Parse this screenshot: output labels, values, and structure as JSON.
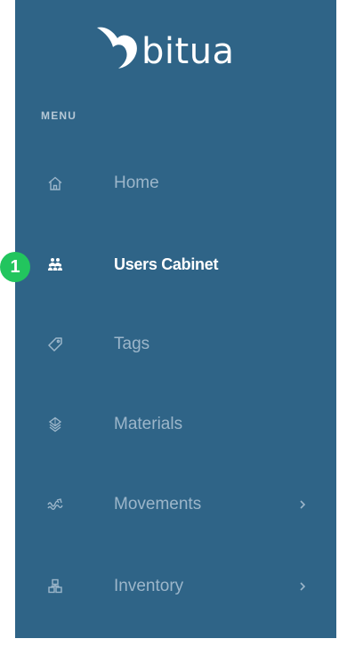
{
  "brand": {
    "name": "bitua",
    "logo_icon": "bitua-swoosh-logo",
    "color": "#ffffff"
  },
  "sidebar": {
    "background": "#2f6487",
    "menu_heading": "MENU",
    "items": [
      {
        "label": "Home",
        "icon": "home-icon",
        "active": false,
        "has_submenu": false
      },
      {
        "label": "Users Cabinet",
        "icon": "users-group-icon",
        "active": true,
        "has_submenu": false
      },
      {
        "label": "Tags",
        "icon": "tag-icon",
        "active": false,
        "has_submenu": false
      },
      {
        "label": "Materials",
        "icon": "layers-icon",
        "active": false,
        "has_submenu": false
      },
      {
        "label": "Movements",
        "icon": "waves-icon",
        "active": false,
        "has_submenu": true
      },
      {
        "label": "Inventory",
        "icon": "boxes-icon",
        "active": false,
        "has_submenu": true
      }
    ]
  },
  "annotation": {
    "label": "1",
    "color": "#22c55e"
  }
}
